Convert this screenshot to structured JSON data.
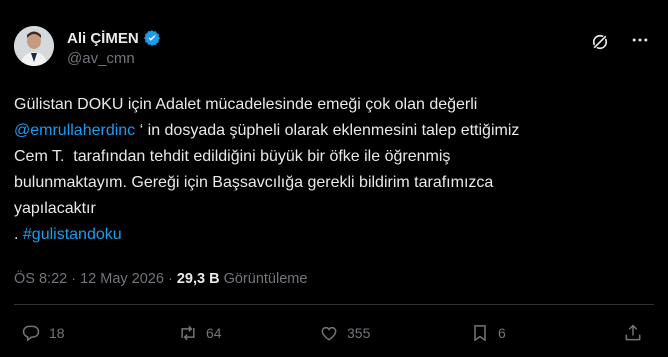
{
  "author": {
    "name": "Ali ÇİMEN",
    "handle": "@av_cmn"
  },
  "icons": {
    "verified": "verified-badge-icon",
    "grok": "grok-icon",
    "more": "more-options-icon"
  },
  "body": {
    "line1": "Gülistan DOKU için Adalet mücadelesinde emeği çok olan değerli",
    "mention": "@emrullaherdinc",
    "line2_rest": " ‘ in dosyada şüpheli olarak eklenmesini talep ettiğimiz",
    "line3": "Cem T.  tarafından tehdit edildiğini büyük bir öfke ile öğrenmiş",
    "line4": "bulunmaktayım. Gereği için Başsavcılığa gerekli bildirim tarafımızca",
    "line5": "yapılacaktır",
    "line6_prefix": ". ",
    "hashtag": "#gulistandoku"
  },
  "meta": {
    "time": "ÖS 8:22",
    "sep": " · ",
    "date": "12 May 2026",
    "sep2": " · ",
    "views": "29,3 B",
    "views_label": " Görüntüleme"
  },
  "actions": {
    "replies": "18",
    "reposts": "64",
    "likes": "355",
    "bookmarks": "6"
  },
  "colors": {
    "background": "#000000",
    "text": "#e7e9ea",
    "muted": "#71767b",
    "link": "#1d9bf0",
    "divider": "#2f3336"
  }
}
